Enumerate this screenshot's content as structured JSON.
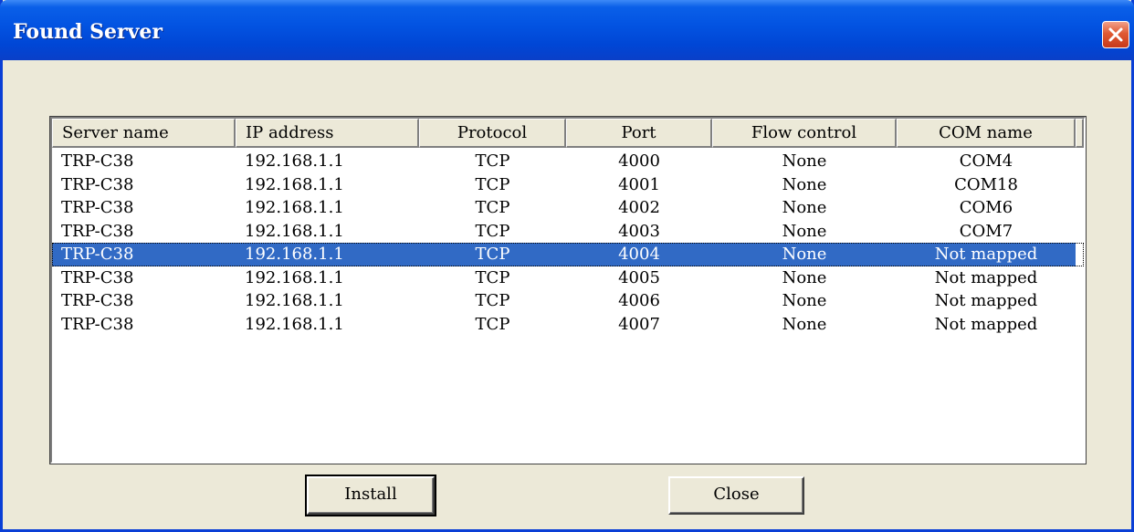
{
  "window": {
    "title": "Found Server"
  },
  "list": {
    "columns": [
      "Server name",
      "IP address",
      "Protocol",
      "Port",
      "Flow control",
      "COM name"
    ],
    "rows": [
      [
        "TRP-C38",
        "192.168.1.1",
        "TCP",
        "4000",
        "None",
        "COM4"
      ],
      [
        "TRP-C38",
        "192.168.1.1",
        "TCP",
        "4001",
        "None",
        "COM18"
      ],
      [
        "TRP-C38",
        "192.168.1.1",
        "TCP",
        "4002",
        "None",
        "COM6"
      ],
      [
        "TRP-C38",
        "192.168.1.1",
        "TCP",
        "4003",
        "None",
        "COM7"
      ],
      [
        "TRP-C38",
        "192.168.1.1",
        "TCP",
        "4004",
        "None",
        "Not mapped"
      ],
      [
        "TRP-C38",
        "192.168.1.1",
        "TCP",
        "4005",
        "None",
        "Not mapped"
      ],
      [
        "TRP-C38",
        "192.168.1.1",
        "TCP",
        "4006",
        "None",
        "Not mapped"
      ],
      [
        "TRP-C38",
        "192.168.1.1",
        "TCP",
        "4007",
        "None",
        "Not mapped"
      ]
    ],
    "selected_row": 4
  },
  "buttons": {
    "install": "Install",
    "close": "Close"
  },
  "icons": {
    "close": "close-icon"
  },
  "colors": {
    "titlebar": "#0046d5",
    "selection": "#316ac5",
    "face": "#ece9d8",
    "close": "#e05a33"
  }
}
